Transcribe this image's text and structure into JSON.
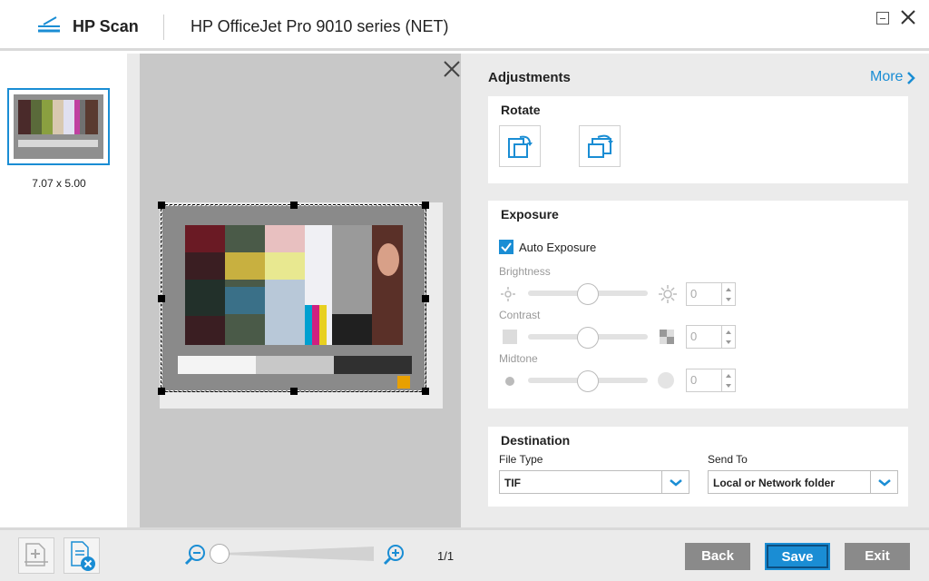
{
  "titlebar": {
    "app_name": "HP Scan",
    "device_name": "HP OfficeJet Pro 9010 series (NET)"
  },
  "thumbnails": [
    {
      "size_label": "7.07  x  5.00"
    }
  ],
  "adjustments": {
    "title": "Adjustments",
    "more_label": "More",
    "rotate": {
      "title": "Rotate"
    },
    "exposure": {
      "title": "Exposure",
      "auto_exposure_label": "Auto Exposure",
      "auto_exposure_checked": true,
      "brightness": {
        "label": "Brightness",
        "value": "0"
      },
      "contrast": {
        "label": "Contrast",
        "value": "0"
      },
      "midtone": {
        "label": "Midtone",
        "value": "0"
      }
    },
    "destination": {
      "title": "Destination",
      "file_type_label": "File Type",
      "file_type_value": "TIF",
      "send_to_label": "Send To",
      "send_to_value": "Local or Network folder"
    }
  },
  "bottombar": {
    "page_count": "1/1",
    "back_label": "Back",
    "save_label": "Save",
    "exit_label": "Exit"
  },
  "colors": {
    "accent": "#1a8dd4",
    "button_gray": "#8a8a8a"
  }
}
